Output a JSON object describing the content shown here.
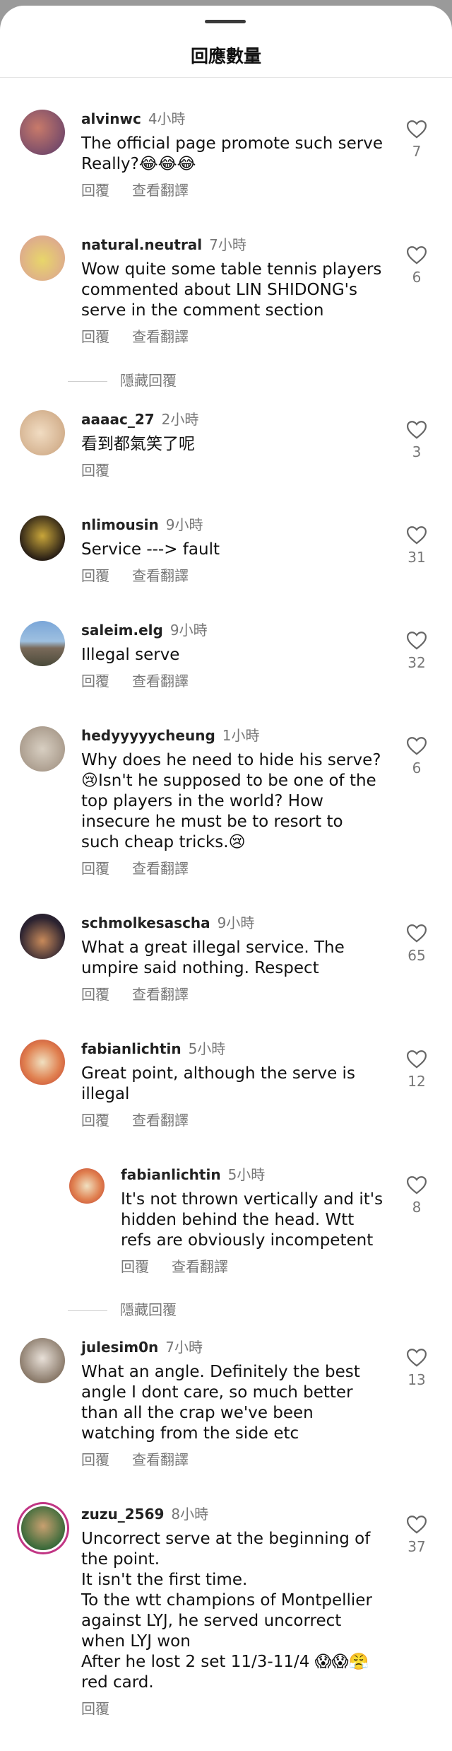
{
  "sheet": {
    "title": "回應數量"
  },
  "labels": {
    "reply": "回覆",
    "translate": "查看翻譯",
    "hide_replies": "隱藏回覆"
  },
  "comments": [
    {
      "user": "alvinwc",
      "time": "4小時",
      "text": "The official page promote such serve\nReally?😂😂😂",
      "likes": "7",
      "translate": true,
      "avatar_color": "#7a5a7a"
    },
    {
      "user": "natural.neutral",
      "time": "7小時",
      "text": "Wow quite some table tennis players commented about LIN SHIDONG's serve in the comment section",
      "likes": "6",
      "translate": true,
      "avatar_color": "#e6d27a"
    },
    {
      "user": "aaaac_27",
      "time": "2小時",
      "text": "看到都氣笑了呢",
      "likes": "3",
      "translate": false,
      "avatar_color": "#d9bfa0"
    },
    {
      "user": "nlimousin",
      "time": "9小時",
      "text": "Service ---> fault",
      "likes": "31",
      "translate": true,
      "avatar_color": "#4a3a2a"
    },
    {
      "user": "saleim.elg",
      "time": "9小時",
      "text": "Illegal serve",
      "likes": "32",
      "translate": true,
      "avatar_color": "#6a8ab0"
    },
    {
      "user": "hedyyyyycheung",
      "time": "1小時",
      "text": "Why does he need to hide his serve? 😢Isn't he supposed to be one of the top players in the world? How insecure he must be to resort to such cheap tricks.😢",
      "likes": "6",
      "translate": true,
      "avatar_color": "#b0a090"
    },
    {
      "user": "schmolkesascha",
      "time": "9小時",
      "text": "What a great illegal service. The umpire said nothing. Respect",
      "likes": "65",
      "translate": true,
      "avatar_color": "#3a3040"
    },
    {
      "user": "fabianlichtin",
      "time": "5小時",
      "text": "Great point, although the serve is illegal",
      "likes": "12",
      "translate": true,
      "avatar_color": "#e05030"
    },
    {
      "user": "fabianlichtin",
      "time": "5小時",
      "text": "It's not thrown vertically and it's hidden behind the head. Wtt refs are obviously incompetent",
      "likes": "8",
      "translate": true,
      "avatar_color": "#e05030"
    },
    {
      "user": "julesim0n",
      "time": "7小時",
      "text": "What an angle. Definitely the best angle I dont care, so much better than all the crap we've been watching from the side etc",
      "likes": "13",
      "translate": true,
      "avatar_color": "#8a7a6a"
    },
    {
      "user": "zuzu_2569",
      "time": "8小時",
      "text": "Uncorrect serve at the beginning of the point.\nIt isn't the first time.\nTo the wtt champions of Montpellier against LYJ, he served uncorrect when LYJ won\nAfter he lost 2 set 11/3-11/4 😱😱😤 red card.",
      "likes": "37",
      "translate": false,
      "avatar_color": "#4a6a3a"
    }
  ]
}
